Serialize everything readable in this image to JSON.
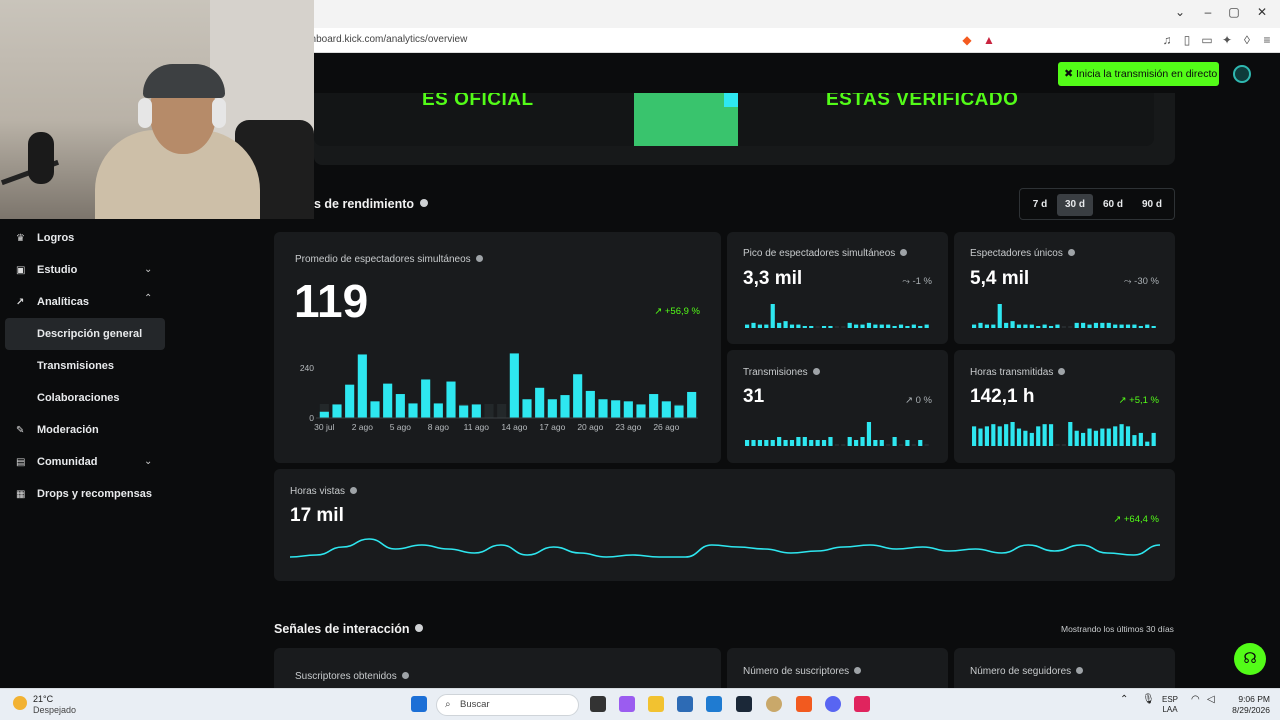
{
  "browser": {
    "url": "ashboard.kick.com/analytics/overview",
    "window_controls": [
      "chevron-down",
      "minimize",
      "maximize",
      "close"
    ]
  },
  "header": {
    "live_button": "Inicia la transmisión en directo",
    "banner_left": "ES OFICIAL",
    "banner_right": "ESTAS VERIFICADO"
  },
  "sidebar": {
    "items": [
      {
        "label": "Logros",
        "icon": "trophy-icon"
      },
      {
        "label": "Estudio",
        "icon": "studio-icon"
      },
      {
        "label": "Analíticas",
        "icon": "analytics-icon"
      },
      {
        "label": "Descripción general"
      },
      {
        "label": "Transmisiones"
      },
      {
        "label": "Colaboraciones"
      },
      {
        "label": "Moderación",
        "icon": "wrench-icon"
      },
      {
        "label": "Comunidad",
        "icon": "community-icon"
      },
      {
        "label": "Drops y recompensas",
        "icon": "gift-icon"
      }
    ]
  },
  "performance": {
    "title": "s de rendimiento",
    "ranges": [
      "7 d",
      "30 d",
      "60 d",
      "90 d"
    ],
    "selected_range": "30 d"
  },
  "main_card": {
    "label": "Promedio de espectadores simultáneos",
    "value": "119",
    "change": "+56,9 %"
  },
  "stats": [
    {
      "label": "Pico de espectadores simultáneos",
      "value": "3,3 mil",
      "change": "-1 %"
    },
    {
      "label": "Espectadores únicos",
      "value": "5,4 mil",
      "change": "-30 %"
    },
    {
      "label": "Transmisiones",
      "value": "31",
      "change": "0 %"
    },
    {
      "label": "Horas transmitidas",
      "value": "142,1 h",
      "change": "+5,1 %"
    }
  ],
  "hours_card": {
    "label": "Horas vistas",
    "value": "17 mil",
    "change": "+64,4 %"
  },
  "engagement": {
    "title": "Señales de interacción",
    "note": "Mostrando los últimos 30 días",
    "cards": [
      "Suscriptores obtenidos",
      "Número de suscriptores",
      "Número de seguidores"
    ]
  },
  "taskbar": {
    "temp": "21°C",
    "weather": "Despejado",
    "search": "Buscar",
    "lang1": "ESP",
    "lang2": "LAA",
    "time": "9:06 PM",
    "date": "8/29/2026"
  },
  "chart_data": {
    "type": "bar",
    "categories": [
      "30 jul",
      "31 jul",
      "1 ago",
      "2 ago",
      "3 ago",
      "4 ago",
      "5 ago",
      "6 ago",
      "7 ago",
      "8 ago",
      "9 ago",
      "10 ago",
      "11 ago",
      "12 ago",
      "13 ago",
      "14 ago",
      "15 ago",
      "16 ago",
      "17 ago",
      "18 ago",
      "19 ago",
      "20 ago",
      "21 ago",
      "22 ago",
      "23 ago",
      "24 ago",
      "25 ago",
      "26 ago",
      "27 ago",
      "28 ago"
    ],
    "x_tick_labels": [
      "30 jul",
      "2 ago",
      "5 ago",
      "8 ago",
      "11 ago",
      "14 ago",
      "17 ago",
      "20 ago",
      "23 ago",
      "26 ago"
    ],
    "values": [
      30,
      65,
      160,
      305,
      80,
      165,
      115,
      70,
      185,
      70,
      175,
      60,
      65,
      0,
      0,
      310,
      90,
      145,
      90,
      110,
      210,
      130,
      90,
      85,
      80,
      65,
      115,
      80,
      60,
      125
    ],
    "y_ticks": [
      0,
      240
    ],
    "ylim": [
      0,
      320
    ]
  }
}
